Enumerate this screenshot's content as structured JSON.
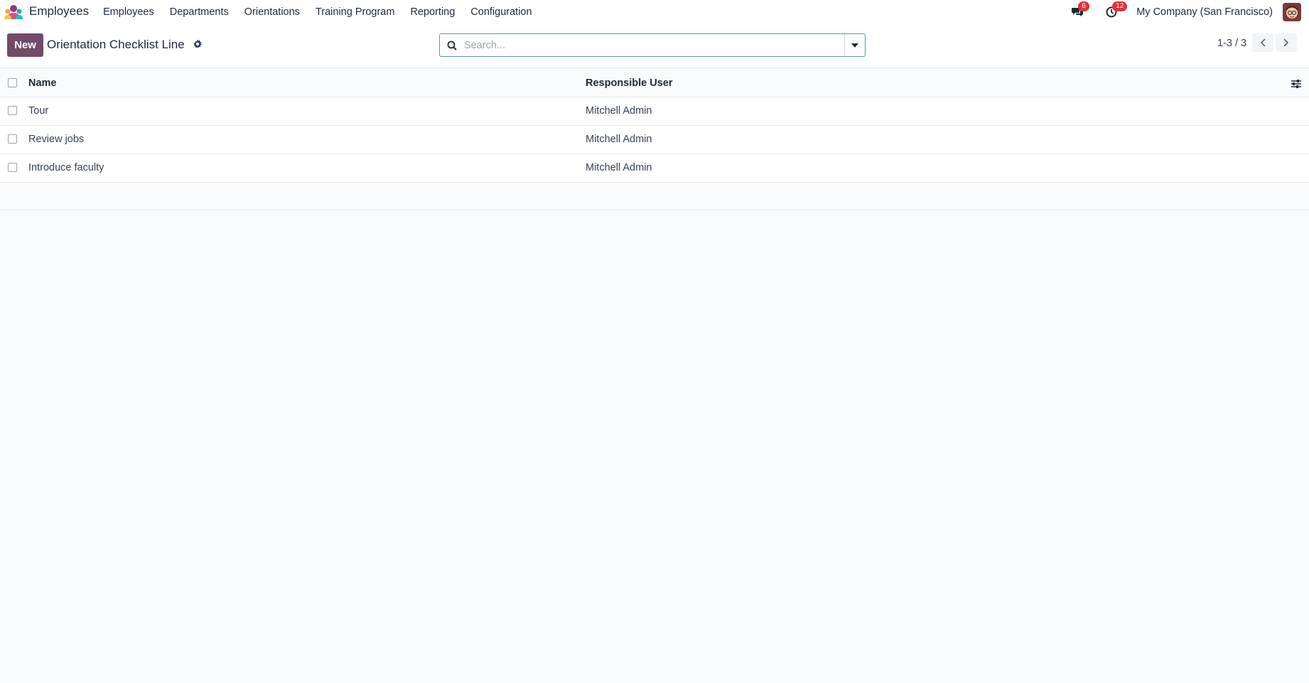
{
  "app": {
    "name": "Employees",
    "menu": [
      "Employees",
      "Departments",
      "Orientations",
      "Training Program",
      "Reporting",
      "Configuration"
    ]
  },
  "systray": {
    "messages_count": "6",
    "activities_count": "12",
    "company": "My Company (San Francisco)"
  },
  "control_panel": {
    "new_label": "New",
    "title": "Orientation Checklist Line",
    "search_placeholder": "Search...",
    "pager": "1-3 / 3"
  },
  "list": {
    "columns": [
      "Name",
      "Responsible User"
    ],
    "rows": [
      {
        "name": "Tour",
        "responsible": "Mitchell Admin"
      },
      {
        "name": "Review jobs",
        "responsible": "Mitchell Admin"
      },
      {
        "name": "Introduce faculty",
        "responsible": "Mitchell Admin"
      }
    ]
  },
  "colors": {
    "brand": "#714b67",
    "badge": "#e0313b",
    "search_border": "#5a9aa0"
  }
}
